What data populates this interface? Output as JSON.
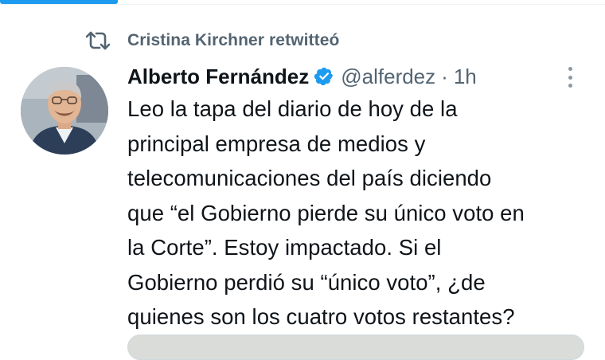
{
  "retweet": {
    "label": "Cristina Kirchner retwitteó",
    "icon": "retweet-icon"
  },
  "tweet": {
    "author_name": "Alberto Fernández",
    "handle": "@alferdez",
    "separator": "·",
    "time": "1h",
    "verified": true,
    "verified_icon": "verified-badge-icon",
    "more_icon": "more-options-icon",
    "text_lines": [
      "Leo la tapa del diario de hoy de la",
      "principal empresa de medios y",
      "telecomunicaciones del país diciendo",
      "que “el Gobierno pierde su único voto en",
      "la Corte”. Estoy impactado. Si el",
      "Gobierno perdió su “único voto”, ¿de",
      "quienes son los cuatro votos restantes?"
    ]
  },
  "colors": {
    "accent": "#1d9bf0",
    "text_primary": "#0f1419",
    "text_secondary": "#536471"
  }
}
